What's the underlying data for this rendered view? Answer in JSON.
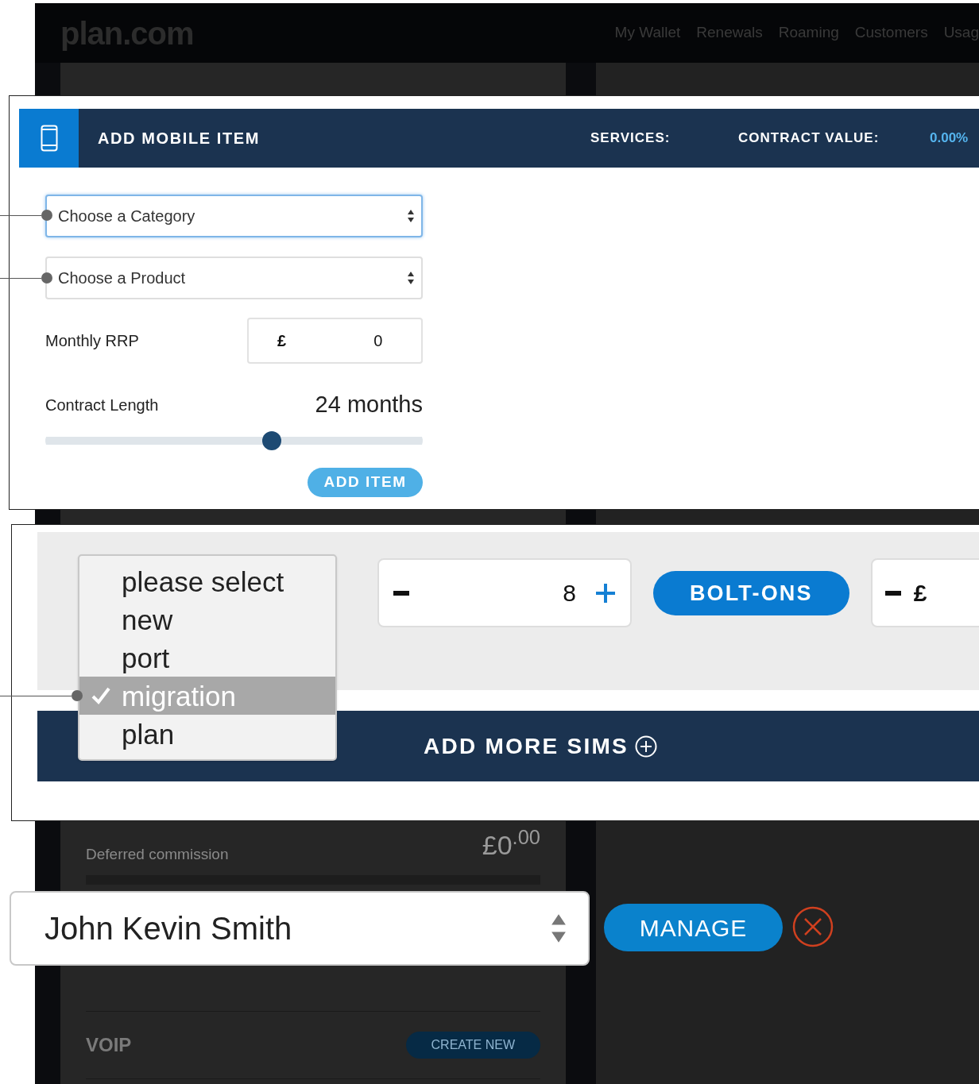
{
  "header": {
    "logo": "plan.com",
    "nav": [
      "My Wallet",
      "Renewals",
      "Roaming",
      "Customers",
      "Usag"
    ]
  },
  "background_panel": {
    "rows": [
      {
        "label": "Deferred commission",
        "amount": "£0$^{.00}$"
      }
    ],
    "voip": {
      "title": "VOIP",
      "button": "CREATE NEW"
    }
  },
  "add_mobile_item": {
    "title": "ADD MOBILE ITEM",
    "services_label": "SERVICES:",
    "contract_value_label": "CONTRACT VALUE:",
    "contract_value": "0.00%",
    "selects": [
      {
        "placeholder": "Choose a Category",
        "focused": true
      },
      {
        "placeholder": "Choose a Product",
        "focused": false
      }
    ],
    "monthly_rrp": {
      "label": "Monthly RRP",
      "currency": "£",
      "value": "0"
    },
    "contract_length": {
      "label": "Contract Length",
      "reading": "24 months",
      "level": 0.6
    },
    "add_button": "ADD ITEM"
  },
  "sim_row": {
    "connection_type_options": [
      {
        "label": "please select",
        "selected": false
      },
      {
        "label": "new",
        "selected": false
      },
      {
        "label": "port",
        "selected": false
      },
      {
        "label": "migration",
        "selected": true
      },
      {
        "label": "plan",
        "selected": false
      }
    ],
    "quantity": {
      "value": "8"
    },
    "bolt_ons_button": "BOLT-ONS",
    "price": {
      "currency": "£"
    },
    "add_more_sims": "ADD MORE SIMS"
  },
  "customer_select": {
    "value": "John Kevin Smith"
  },
  "manage_button": "MANAGE"
}
